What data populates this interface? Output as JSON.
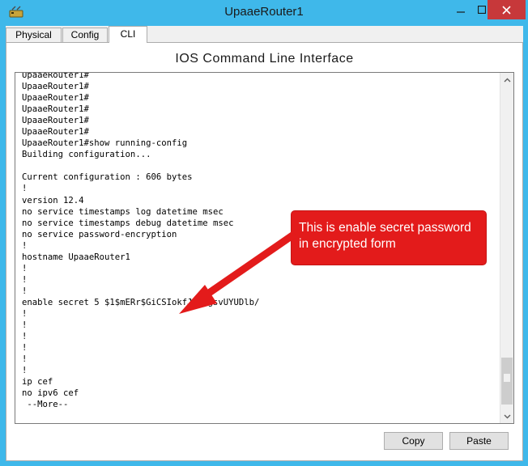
{
  "window": {
    "title": "UpaaeRouter1",
    "icon": "router-app-icon",
    "controls": {
      "minimize": "minimize-icon",
      "maximize": "maximize-icon",
      "close": "close-icon"
    }
  },
  "tabs": [
    {
      "label": "Physical",
      "active": false
    },
    {
      "label": "Config",
      "active": false
    },
    {
      "label": "CLI",
      "active": true
    }
  ],
  "panel": {
    "title": "IOS Command Line Interface"
  },
  "console": {
    "lines": [
      "UpaaeRouter1#",
      "UpaaeRouter1#",
      "UpaaeRouter1#",
      "UpaaeRouter1#",
      "UpaaeRouter1#",
      "UpaaeRouter1#",
      "UpaaeRouter1#show running-config",
      "Building configuration...",
      "",
      "Current configuration : 606 bytes",
      "!",
      "version 12.4",
      "no service timestamps log datetime msec",
      "no service timestamps debug datetime msec",
      "no service password-encryption",
      "!",
      "hostname UpaaeRouter1",
      "!",
      "!",
      "!",
      "enable secret 5 $1$mERr$GiCSIokfJFmAgsvUYUDlb/",
      "!",
      "!",
      "!",
      "!",
      "!",
      "!",
      "ip cef",
      "no ipv6 cef",
      " --More--"
    ]
  },
  "annotation": {
    "text_line1": "This is enable secret password",
    "text_line2": "in encrypted form",
    "color": "#e31b1b"
  },
  "buttons": {
    "copy": "Copy",
    "paste": "Paste"
  }
}
